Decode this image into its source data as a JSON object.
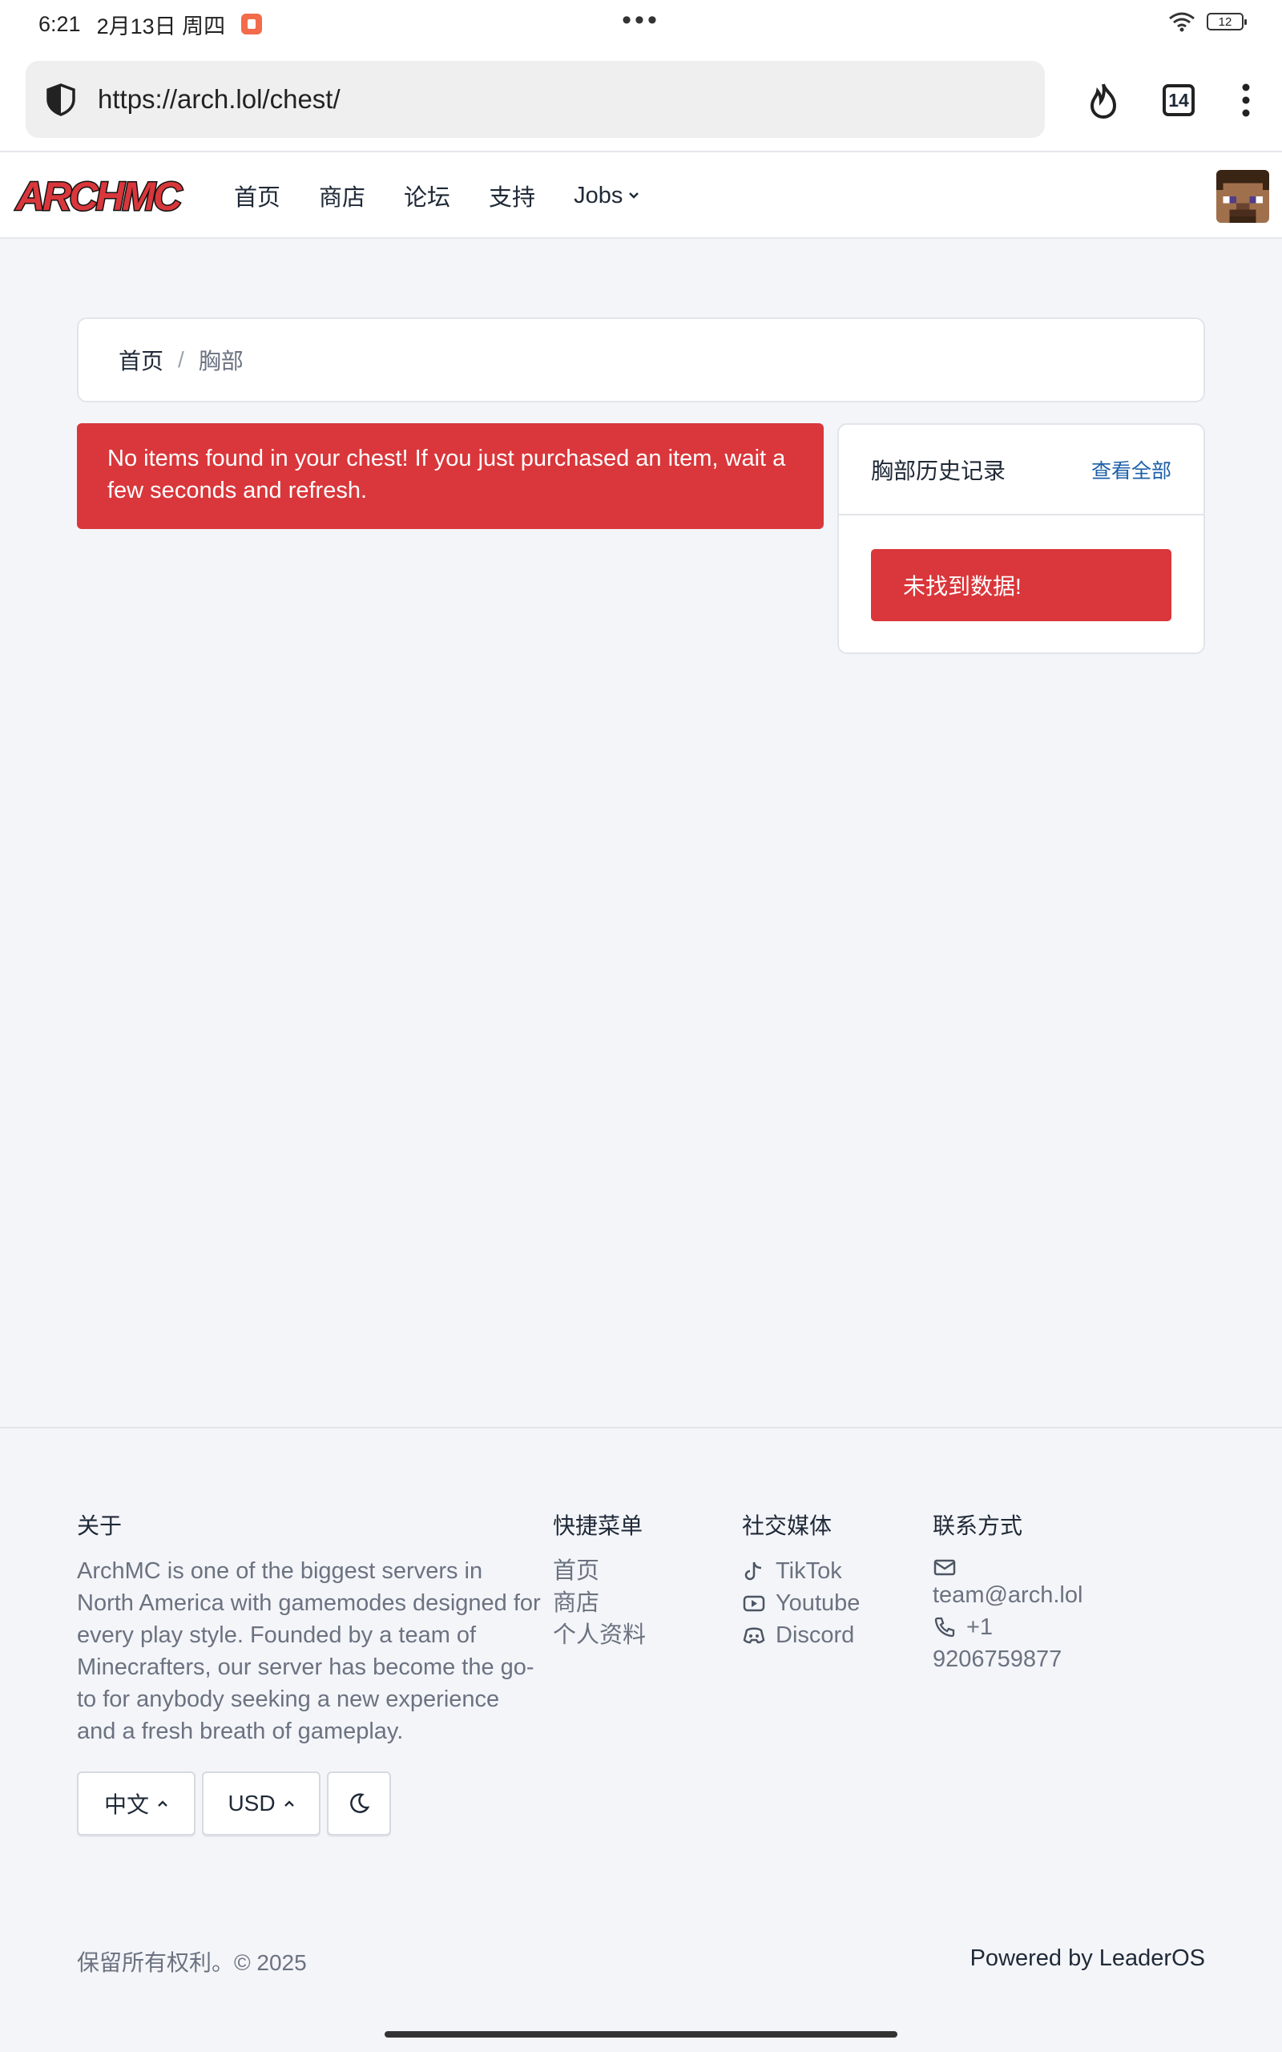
{
  "status_bar": {
    "time": "6:21",
    "date": "2月13日 周四",
    "dots": "•••",
    "battery": "12"
  },
  "browser": {
    "url": "https://arch.lol/chest/",
    "tabs_count": "14"
  },
  "nav": {
    "logo_text": "ARCHMC",
    "links": [
      "首页",
      "商店",
      "论坛",
      "支持",
      "Jobs"
    ]
  },
  "breadcrumb": {
    "home": "首页",
    "separator": "/",
    "current": "胸部"
  },
  "alert_main": "No items found in your chest! If you just purchased an item, wait a few seconds and refresh.",
  "history": {
    "title": "胸部历史记录",
    "view_all": "查看全部",
    "empty": "未找到数据!"
  },
  "footer": {
    "about_heading": "关于",
    "about_text": "ArchMC is one of the biggest servers in North America with gamemodes designed for every play style. Founded by a team of Minecrafters, our server has become the go-to for anybody seeking a new experience and a fresh breath of gameplay.",
    "quick_heading": "快捷菜单",
    "quick_links": [
      "首页",
      "商店",
      "个人资料"
    ],
    "social_heading": "社交媒体",
    "social_links": [
      "TikTok",
      "Youtube",
      "Discord"
    ],
    "contact_heading": "联系方式",
    "email": "team@arch.lol",
    "phone_prefix": "+1",
    "phone_number": "9206759877",
    "language_button": "中文",
    "currency_button": "USD",
    "copyright": "保留所有权利。© 2025",
    "powered_by": "Powered by LeaderOS"
  },
  "colors": {
    "alert": "#d9373b",
    "link": "#1d5fa8",
    "background": "#f4f5f9"
  }
}
